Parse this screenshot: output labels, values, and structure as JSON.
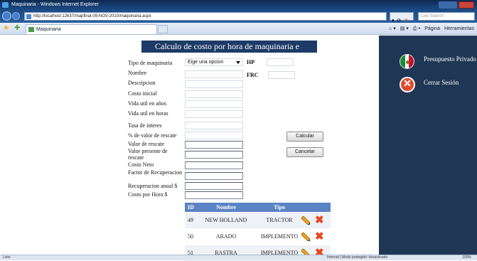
{
  "window": {
    "title": "Maquinaria - Windows Internet Explorer"
  },
  "address": {
    "url": "http://localhost:12637/mapfinal-09-NOV-2010/maquinaria.aspx",
    "search_placeholder": "Live Search"
  },
  "tabs": [
    {
      "label": "Maquinaria"
    }
  ],
  "commands": {
    "pagina": "Página",
    "herramientas": "Herramientas"
  },
  "page": {
    "title": "Calculo de costo por hora de maquinaria e"
  },
  "form": {
    "tipo_label": "Tipo de maquinaria",
    "tipo_value": "Eige una opcion",
    "hp_label": "HP",
    "frc_label": "FRC",
    "fields": [
      "Nombre",
      "Descripcion",
      "Costo inicial",
      "Vida util en años",
      "Vida util en horas",
      "Tasa de interes",
      "% de valor de rescate",
      "Valor de rescate",
      "Valor presente de rescate",
      "Costo Neto",
      "Factor de Recuperacion",
      "Recuperacion anual $",
      "Costo por Hora $"
    ],
    "calcular": "Calcular",
    "cancelar": "Cancelar"
  },
  "grid": {
    "headers": [
      "ID",
      "Nombre",
      "Tipo"
    ],
    "rows": [
      {
        "id": "49",
        "nombre": "NEW HOLLAND",
        "tipo": "TRACTOR"
      },
      {
        "id": "50",
        "nombre": "ARADO",
        "tipo": "IMPLEMENTO"
      },
      {
        "id": "51",
        "nombre": "RASTRA",
        "tipo": "IMPLEMENTO"
      }
    ]
  },
  "sidebar": {
    "presupuesto": "Presupuesto Privado",
    "cerrar": "Cerrar Sesión"
  },
  "status": {
    "left": "Listo",
    "middle": "Internet | Modo protegido: desactivado",
    "zoom": "100%"
  }
}
